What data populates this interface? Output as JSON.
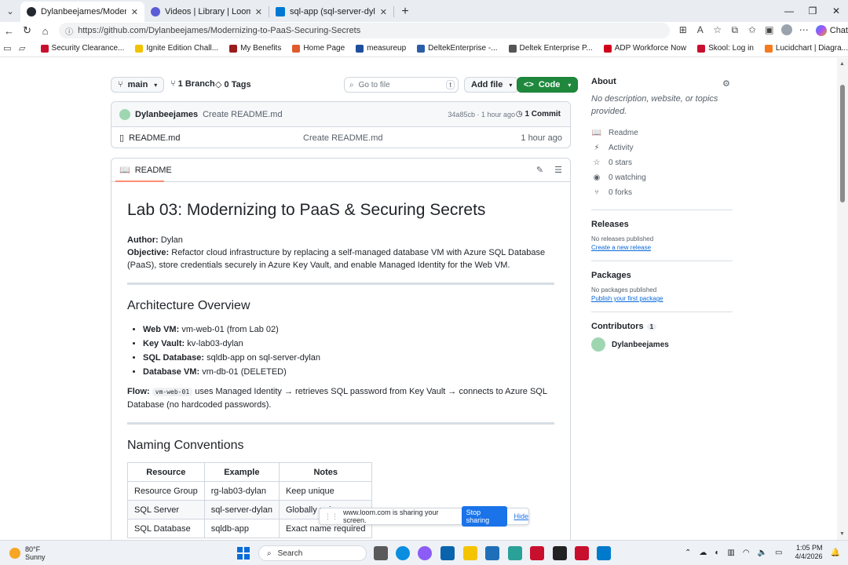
{
  "browser": {
    "tabs": [
      {
        "title": "Dylanbeejames/Modernizing-to-P",
        "color": "#24292f",
        "active": true
      },
      {
        "title": "Videos | Library | Loom",
        "color": "#5b5bd6",
        "active": false
      },
      {
        "title": "sql-app (sql-server-dylan/sql-app)",
        "color": "#0078d4",
        "active": false
      }
    ],
    "url": "https://github.com/Dylanbeejames/Modernizing-to-PaaS-Securing-Secrets",
    "chat_label": "Chat",
    "favorites": [
      {
        "label": "Security Clearance...",
        "color": "#c8102e"
      },
      {
        "label": "Ignite Edition Chall...",
        "color": "#f2c200"
      },
      {
        "label": "My Benefits",
        "color": "#9b1c1c"
      },
      {
        "label": "Home Page",
        "color": "#e05a2b"
      },
      {
        "label": "measureup",
        "color": "#1f4e9c"
      },
      {
        "label": "DeltekEnterprise -...",
        "color": "#2c5ea8"
      },
      {
        "label": "Deltek Enterprise P...",
        "color": "#555555"
      },
      {
        "label": "ADP Workforce Now",
        "color": "#d0021b"
      },
      {
        "label": "Skool: Log in",
        "color": "#c8102e"
      },
      {
        "label": "Lucidchart | Diagra...",
        "color": "#f47b20"
      }
    ]
  },
  "repo": {
    "branch": "main",
    "branches": "1 Branch",
    "tags": "0 Tags",
    "goto_placeholder": "Go to file",
    "goto_key": "t",
    "add_file": "Add file",
    "code": "Code",
    "commit_user": "Dylanbeejames",
    "commit_msg": "Create README.md",
    "commit_sha": "34a85cb · 1 hour ago",
    "commit_count": "1 Commit",
    "files": [
      {
        "name": "README.md",
        "message": "Create README.md",
        "age": "1 hour ago"
      }
    ]
  },
  "readme": {
    "tab_label": "README",
    "title": "Lab 03: Modernizing to PaaS & Securing Secrets",
    "author_label": "Author:",
    "author": "Dylan",
    "objective_label": "Objective:",
    "objective": "Refactor cloud infrastructure by replacing a self-managed database VM with Azure SQL Database (PaaS), store credentials securely in Azure Key Vault, and enable Managed Identity for the Web VM.",
    "arch_heading": "Architecture Overview",
    "arch_items": [
      {
        "label": "Web VM:",
        "value": "vm-web-01 (from Lab 02)"
      },
      {
        "label": "Key Vault:",
        "value": "kv-lab03-dylan"
      },
      {
        "label": "SQL Database:",
        "value": "sqldb-app on sql-server-dylan"
      },
      {
        "label": "Database VM:",
        "value": "vm-db-01 (DELETED)"
      }
    ],
    "flow_label": "Flow:",
    "flow_code": "vm-web-01",
    "flow_text": "uses Managed Identity → retrieves SQL password from Key Vault → connects to Azure SQL Database (no hardcoded passwords).",
    "naming_heading": "Naming Conventions",
    "table_headers": [
      "Resource",
      "Example",
      "Notes"
    ],
    "table_rows": [
      [
        "Resource Group",
        "rg-lab03-dylan",
        "Keep unique"
      ],
      [
        "SQL Server",
        "sql-server-dylan",
        "Globally uni"
      ],
      [
        "SQL Database",
        "sqldb-app",
        "Exact name required"
      ]
    ]
  },
  "sidebar": {
    "about": "About",
    "description": "No description, website, or topics provided.",
    "stats": [
      {
        "icon": "book-icon",
        "glyph": "📖",
        "label": "Readme"
      },
      {
        "icon": "activity-icon",
        "glyph": "⚡",
        "label": "Activity"
      },
      {
        "icon": "star-icon",
        "glyph": "☆",
        "label": "0 stars"
      },
      {
        "icon": "eye-icon",
        "glyph": "◉",
        "label": "0 watching"
      },
      {
        "icon": "fork-icon",
        "glyph": "⑂",
        "label": "0 forks"
      }
    ],
    "releases": "Releases",
    "no_releases": "No releases published",
    "create_release": "Create a new release",
    "packages": "Packages",
    "no_packages": "No packages published",
    "publish_package": "Publish your first package",
    "contributors": "Contributors",
    "contributors_count": "1",
    "contributor_name": "Dylanbeejames"
  },
  "loom": {
    "message": "www.loom.com is sharing your screen.",
    "stop": "Stop sharing",
    "hide": "Hide"
  },
  "taskbar": {
    "temp": "80°F",
    "condition": "Sunny",
    "search": "Search",
    "time": "1:05 PM",
    "date": "4/4/2026"
  }
}
